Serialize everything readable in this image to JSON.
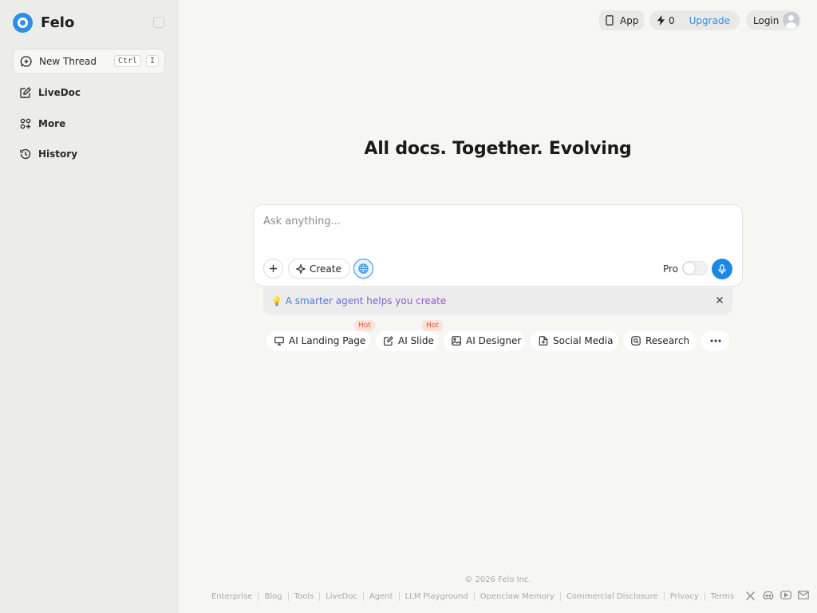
{
  "brand": {
    "name": "Felo"
  },
  "sidebar": {
    "new_thread": {
      "label": "New Thread",
      "shortcut_mod": "Ctrl",
      "shortcut_key": "I"
    },
    "items": [
      {
        "label": "LiveDoc",
        "icon": "edit-icon"
      },
      {
        "label": "More",
        "icon": "apps-icon"
      },
      {
        "label": "History",
        "icon": "history-icon"
      }
    ]
  },
  "header": {
    "app_label": "App",
    "credits": "0",
    "upgrade_label": "Upgrade",
    "login_label": "Login"
  },
  "main": {
    "headline": "All docs. Together. Evolving",
    "search": {
      "placeholder": "Ask anything...",
      "value": ""
    },
    "create_label": "Create",
    "pro_label": "Pro",
    "tip": {
      "emoji": "💡",
      "text": "A smarter agent helps you create"
    },
    "chips": [
      {
        "label": "AI Landing Page",
        "icon": "monitor-icon",
        "badge": "Hot"
      },
      {
        "label": "AI Slide",
        "icon": "slide-edit-icon",
        "badge": "Hot"
      },
      {
        "label": "AI Designer",
        "icon": "image-icon",
        "badge": ""
      },
      {
        "label": "Social Media",
        "icon": "doc-plus-icon",
        "badge": ""
      },
      {
        "label": "Research",
        "icon": "research-icon",
        "badge": ""
      }
    ]
  },
  "footer": {
    "copyright": "© 2026 Felo Inc.",
    "links": [
      "Enterprise",
      "Blog",
      "Tools",
      "LiveDoc",
      "Agent",
      "LLM Playground",
      "Openclaw Memory",
      "Commercial Disclosure",
      "Privacy",
      "Terms"
    ],
    "social": [
      "x-icon",
      "discord-icon",
      "youtube-icon",
      "mail-icon"
    ]
  },
  "colors": {
    "accent": "#2f8fe6",
    "hot": "#e0582e",
    "hot_bg": "#fbe3dc"
  }
}
